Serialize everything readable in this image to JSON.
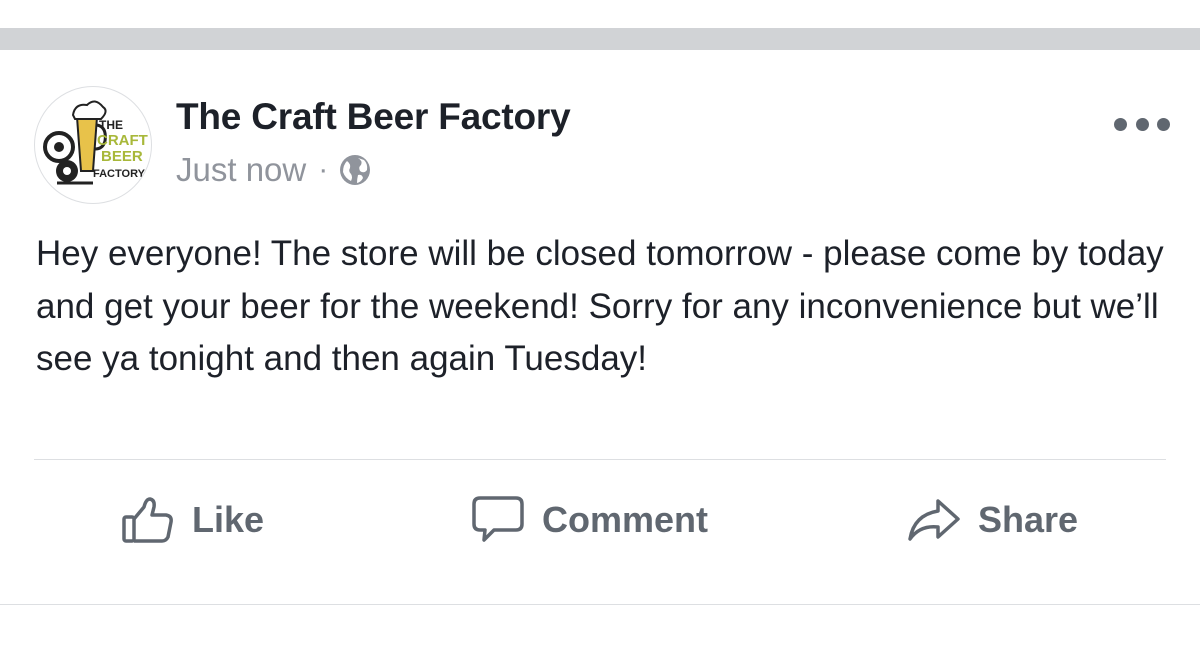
{
  "post": {
    "author": "The Craft Beer Factory",
    "timestamp": "Just now",
    "separator": "·",
    "privacy_icon": "globe-icon",
    "more_icon": "more-options-icon",
    "body": "Hey everyone! The store will be closed tomorrow - please come by today and get your beer for the weekend! Sorry for any inconvenience but we’ll see ya tonight and then again Tuesday!"
  },
  "avatar": {
    "logo_text": [
      "THE",
      "CRAFT",
      "BEER",
      "FACTORY"
    ]
  },
  "actions": {
    "like_label": "Like",
    "comment_label": "Comment",
    "share_label": "Share"
  },
  "colors": {
    "author": "#1d2129",
    "secondary": "#90949c",
    "action": "#606770",
    "top_bar": "#d1d3d6",
    "divider": "#dddfe2",
    "logo_green": "#a8b83a"
  }
}
